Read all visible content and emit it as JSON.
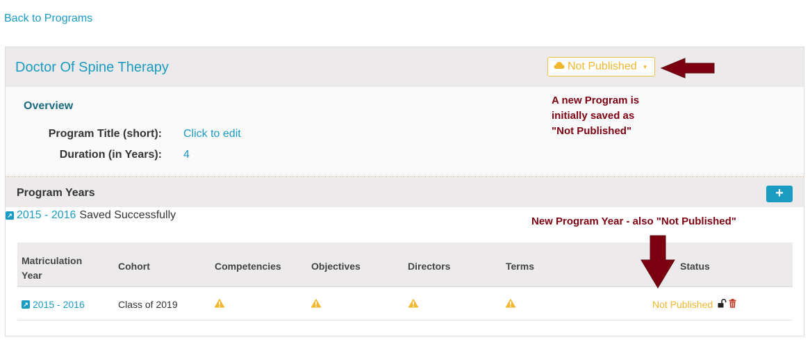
{
  "back_link": "Back to Programs",
  "program": {
    "title": "Doctor Of Spine Therapy",
    "publish_status": "Not Published",
    "cloud_icon": "cloud-icon",
    "caret_icon": "caret-down-icon"
  },
  "overview": {
    "title": "Overview",
    "rows": [
      {
        "label": "Program Title (short):",
        "value": "Click to edit"
      },
      {
        "label": "Duration (in Years):",
        "value": "4"
      }
    ]
  },
  "annotations": {
    "program_note_line1": "A new Program is",
    "program_note_line2": "initially saved as",
    "program_note_line3": "\"Not Published\"",
    "year_note": "New Program Year - also \"Not Published\""
  },
  "program_years": {
    "title": "Program Years",
    "add_label": "+",
    "saved_year": "2015 - 2016",
    "saved_message": "Saved Successfully",
    "columns": {
      "matriculation_line1": "Matriculation",
      "matriculation_line2": "Year",
      "cohort": "Cohort",
      "competencies": "Competencies",
      "objectives": "Objectives",
      "directors": "Directors",
      "terms": "Terms",
      "status": "Status"
    },
    "rows": [
      {
        "year": "2015 - 2016",
        "cohort": "Class of 2019",
        "competencies_icon": "warning-icon",
        "objectives_icon": "warning-icon",
        "directors_icon": "warning-icon",
        "terms_icon": "warning-icon",
        "status": "Not Published"
      }
    ]
  },
  "colors": {
    "link": "#1a9bc1",
    "warning": "#f0b72f",
    "annotation": "#7d0011"
  }
}
